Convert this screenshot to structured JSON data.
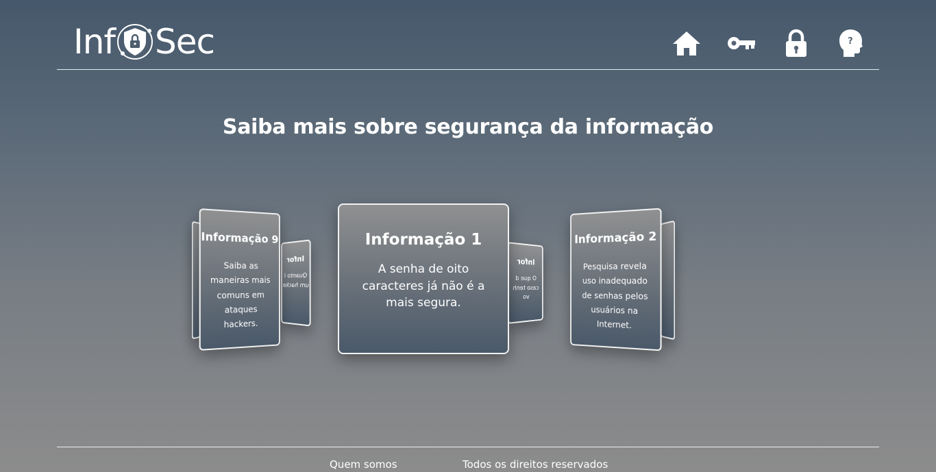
{
  "logo": {
    "left_text": "Inf",
    "right_text": "Sec"
  },
  "nav": {
    "icons": [
      "home-icon",
      "key-icon",
      "lock-icon",
      "head-question-icon"
    ]
  },
  "main": {
    "title": "Saiba mais sobre segurança da informação",
    "cards": [
      {
        "title": "Informação 9",
        "text": "Saiba as maneiras mais comuns em ataques hackers."
      },
      {
        "title": "Informação 1",
        "text": "A senha de oito caracteres já não é a mais segura."
      },
      {
        "title": "Informação 2",
        "text": "Pesquisa revela uso inadequado de senhas pelos usuários na Internet."
      }
    ],
    "back_cards": [
      {
        "title": "Infor",
        "text": "Quanto I\num hacke"
      },
      {
        "title": "Infor",
        "text": "O que d\ncaso tenh\nvo"
      }
    ]
  },
  "footer": {
    "about": "Quem somos",
    "rights": "Todos os direitos reservados"
  },
  "colors": {
    "accent": "#ffffff",
    "bg_top": "#45586b",
    "bg_bottom": "#8c8c8c"
  }
}
